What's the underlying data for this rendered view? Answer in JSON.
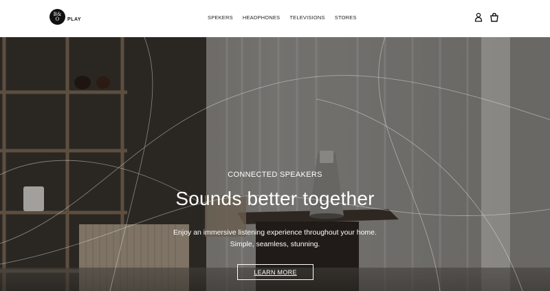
{
  "brand": {
    "logo_top": "B&",
    "logo_bottom": "O",
    "logo_suffix": "PLAY"
  },
  "nav": {
    "items": [
      {
        "label": "SPEKERS"
      },
      {
        "label": "HEADPHONES"
      },
      {
        "label": "TELEVISIONS"
      },
      {
        "label": "STORES"
      }
    ]
  },
  "header_icons": {
    "account": "user-icon",
    "cart": "shopping-bag-icon"
  },
  "hero": {
    "eyebrow": "CONNECTED SPEAKERS",
    "headline": "Sounds better together",
    "body_line1": "Enjoy an immersive listening experience throughout your home.",
    "body_line2": "Simple, seamless, stunning.",
    "cta_label": "LEARN MORE"
  },
  "colors": {
    "text_dark": "#222222",
    "hero_text": "#ffffff",
    "header_bg": "#ffffff"
  }
}
